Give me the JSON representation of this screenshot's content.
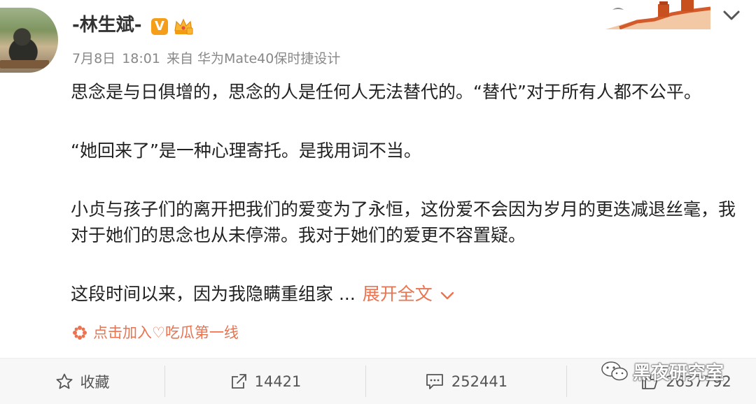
{
  "user": {
    "name": "-林生斌-",
    "vip_badge": "V"
  },
  "meta": {
    "date": "7月8日",
    "time": "18:01",
    "source": "来自 华为Mate40保时捷设计"
  },
  "post": {
    "paragraphs": [
      "思念是与日俱增的，思念的人是任何人无法替代的。“替代”对于所有人都不公平。",
      "“她回来了”是一种心理寄托。是我用词不当。",
      "小贞与孩子们的离开把我们的爱变为了永恒，这份爱不会因为岁月的更迭减退丝毫，我对于她们的思念也从未停滞。我对于她们的爱更不容置疑。",
      "这段时间以来，因为我隐瞒重组家 ..."
    ],
    "expand_label": "展开全文",
    "topic": "点击加入♡吃瓜第一线"
  },
  "actions": {
    "favorite_label": "收藏",
    "repost_count": "14421",
    "comment_count": "252441",
    "like_count": "2637792"
  },
  "watermark": "黑夜研究室",
  "icons": [
    "chevron-down-icon",
    "crown-icon",
    "flower-icon",
    "star-icon",
    "share-icon",
    "comment-icon",
    "thumb-up-icon",
    "wechat-icon"
  ],
  "colors": {
    "accent": "#eb7350",
    "vip": "#f59e1a",
    "meta_gray": "#888888"
  }
}
